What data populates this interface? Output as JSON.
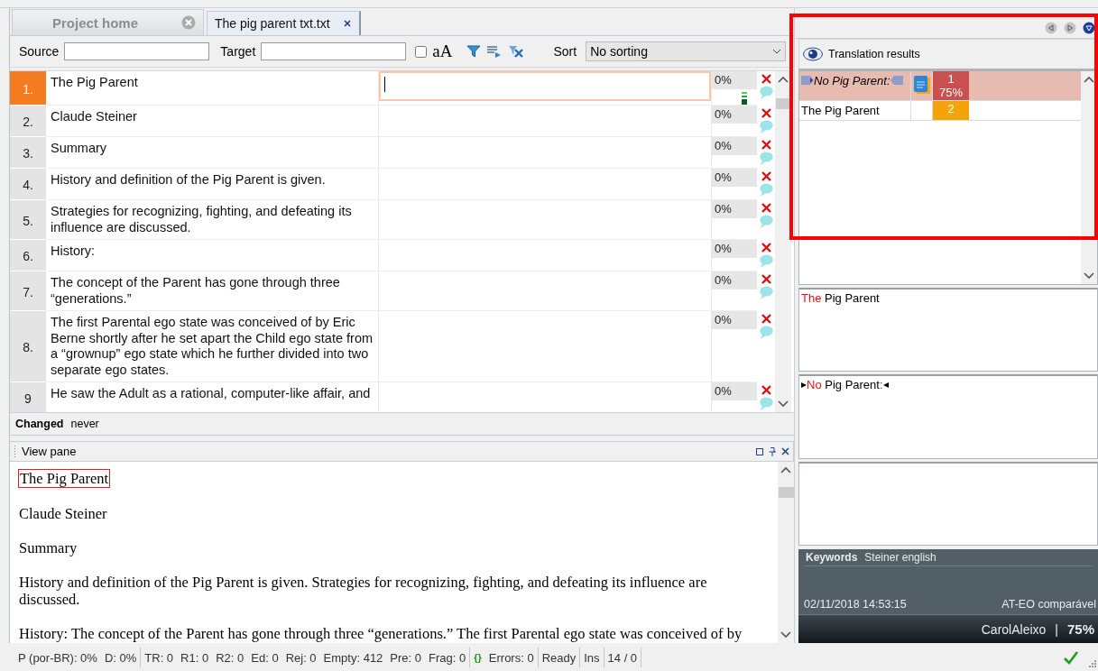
{
  "tabs": [
    {
      "label": "Project home",
      "selected": false
    },
    {
      "label": "The pig parent txt.txt",
      "selected": true
    }
  ],
  "filter": {
    "source_label": "Source",
    "target_label": "Target",
    "case_checked": false,
    "case_label": "aA",
    "sort_label": "Sort",
    "sort_value": "No sorting"
  },
  "segments": [
    {
      "number": "1.",
      "source": "The Pig Parent",
      "match": "0%",
      "selected": true
    },
    {
      "number": "2.",
      "source": "Claude Steiner",
      "match": "0%",
      "selected": false
    },
    {
      "number": "3.",
      "source": "Summary",
      "match": "0%",
      "selected": false
    },
    {
      "number": "4.",
      "source": "History and definition of the Pig Parent is given.",
      "match": "0%",
      "selected": false
    },
    {
      "number": "5.",
      "source": "Strategies for recognizing, fighting, and defeating its influence are discussed.",
      "match": "0%",
      "selected": false
    },
    {
      "number": "6.",
      "source": "History:",
      "match": "0%",
      "selected": false
    },
    {
      "number": "7.",
      "source": "The concept of the Parent has gone through three “generations.”",
      "match": "0%",
      "selected": false
    },
    {
      "number": "8.",
      "source": "The first Parental ego state was conceived of by Eric Berne shortly after he set apart the Child ego state from a “grownup” ego state which he further divided into two separate ego states.",
      "match": "0%",
      "selected": false
    },
    {
      "number": "9",
      "source": "He saw the Adult as a rational, computer-like affair, and",
      "match": "0%",
      "selected": false
    }
  ],
  "changed": {
    "label": "Changed",
    "value": "never"
  },
  "view_pane": {
    "title": "View pane",
    "paragraphs": [
      {
        "text": "The Pig Parent",
        "selected": true
      },
      {
        "text": "Claude Steiner",
        "selected": false
      },
      {
        "text": "Summary",
        "selected": false
      },
      {
        "text": "History and definition of the Pig Parent is given. Strategies for recognizing, fighting, and defeating its influence are discussed.",
        "selected": false
      },
      {
        "text": "History: The concept of the Parent has gone through three “generations.” The first Parental ego state was conceived of by",
        "selected": false
      }
    ]
  },
  "translation_results": {
    "title": "Translation results",
    "rows": [
      {
        "kind": "tm",
        "text": "No Pig Parent:",
        "badge": "1",
        "percent": "75%",
        "color": "#c9504e",
        "selected": true
      },
      {
        "kind": "term",
        "text": "The Pig Parent",
        "badge": "2",
        "color": "#f5a30a",
        "selected": false
      }
    ]
  },
  "source_preview": [
    {
      "kind": "diff",
      "text": "The"
    },
    {
      "kind": "plain",
      "text": " Pig Parent"
    }
  ],
  "target_preview": [
    {
      "kind": "tag"
    },
    {
      "kind": "diff",
      "text": "No"
    },
    {
      "kind": "plain",
      "text": " Pig Parent"
    },
    {
      "kind": "punct",
      "text": ":"
    },
    {
      "kind": "tag"
    }
  ],
  "info": {
    "keywords_label": "Keywords",
    "keywords": "Steiner english",
    "date": "02/11/2018 14:53:15",
    "memory": "AT-EO comparável",
    "user": "CarolAleixo",
    "separator": "|",
    "percent": "75%"
  },
  "status_bar": [
    [
      {
        "text": "P (por-BR): 0%"
      },
      {
        "text": "D: 0%"
      }
    ],
    [
      {
        "text": "TR: 0"
      },
      {
        "text": "R1: 0"
      },
      {
        "text": "R2: 0"
      },
      {
        "text": "Ed: 0"
      },
      {
        "text": "Rej: 0"
      },
      {
        "text": "Empty: 412"
      },
      {
        "text": "Pre: 0"
      },
      {
        "text": "Frag: 0"
      }
    ],
    [
      {
        "icon": "{}",
        "text": "Errors: 0"
      }
    ],
    [
      {
        "text": "Ready"
      }
    ],
    [
      {
        "text": "Ins"
      }
    ],
    [
      {
        "text": "14 / 0"
      }
    ]
  ]
}
